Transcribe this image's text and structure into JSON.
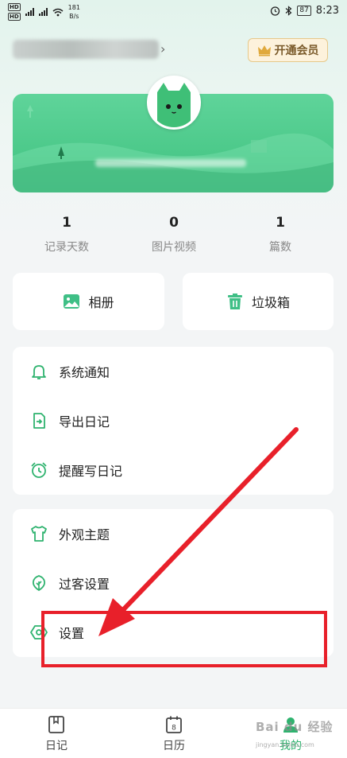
{
  "status_bar": {
    "net_speed_value": "181",
    "net_speed_unit": "B/s",
    "battery": "87",
    "time": "8:23"
  },
  "header": {
    "vip_label": "开通会员"
  },
  "stats": [
    {
      "value": "1",
      "label": "记录天数"
    },
    {
      "value": "0",
      "label": "图片视频"
    },
    {
      "value": "1",
      "label": "篇数"
    }
  ],
  "quick_actions": {
    "album_label": "相册",
    "trash_label": "垃圾箱"
  },
  "menu_group_1": [
    {
      "label": "系统通知",
      "icon": "bell-icon"
    },
    {
      "label": "导出日记",
      "icon": "export-icon"
    },
    {
      "label": "提醒写日记",
      "icon": "alarm-clock-icon"
    }
  ],
  "menu_group_2": [
    {
      "label": "外观主题",
      "icon": "tshirt-icon"
    },
    {
      "label": "过客设置",
      "icon": "leaf-icon"
    },
    {
      "label": "设置",
      "icon": "settings-icon"
    }
  ],
  "bottom_nav": [
    {
      "label": "日记",
      "icon": "diary-book-icon",
      "active": false
    },
    {
      "label": "日历",
      "icon": "calendar-icon",
      "active": false,
      "icon_text": "8"
    },
    {
      "label": "我的",
      "icon": "profile-icon",
      "active": true
    }
  ],
  "watermark": {
    "text": "Bai du 经验",
    "sub": "jingyan.baidu.com"
  },
  "colors": {
    "accent": "#2fb36f",
    "banner": "#4cc98a",
    "annotation": "#e8202a"
  }
}
